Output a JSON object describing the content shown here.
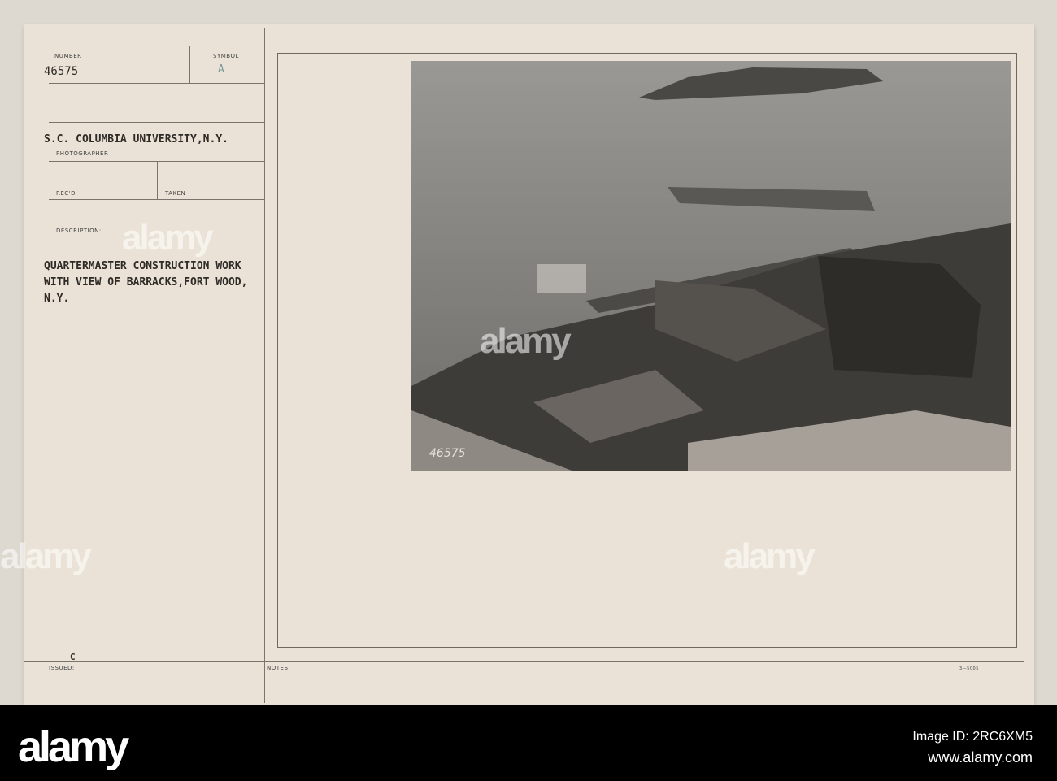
{
  "card": {
    "number_label": "NUMBER",
    "number": "46575",
    "symbol_label": "SYMBOL",
    "symbol": "A",
    "photographer": "S.C. COLUMBIA UNIVERSITY,N.Y.",
    "photographer_label": "PHOTOGRAPHER",
    "recd_label": "REC'D",
    "taken_label": "TAKEN",
    "description_label": "DESCRIPTION:",
    "description_lines": [
      "QUARTERMASTER CONSTRUCTION WORK",
      "WITH VIEW OF BARRACKS,FORT WOOD,",
      "N.Y."
    ],
    "issued_label": "ISSUED:",
    "issued_mark": "C",
    "notes_label": "NOTES:",
    "form_number": "3—5005"
  },
  "photo": {
    "negative_number": "46575"
  },
  "watermark": {
    "text": "alamy",
    "image_id": "Image ID: 2RC6XM5",
    "url": "www.alamy.com"
  }
}
